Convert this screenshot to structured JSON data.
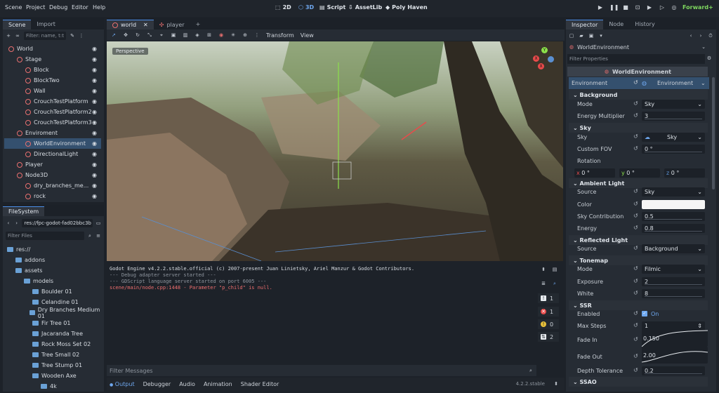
{
  "menu": [
    "Scene",
    "Project",
    "Debug",
    "Editor",
    "Help"
  ],
  "workspaces": {
    "w2d": "2D",
    "w3d": "3D",
    "script": "Script",
    "assetlib": "AssetLib",
    "polyhaven": "Poly Haven"
  },
  "renderer": "Forward+",
  "scene_dock": {
    "tabs": [
      "Scene",
      "Import"
    ],
    "filter_placeholder": "Filter: name, t:t",
    "nodes": [
      {
        "label": "World",
        "indent": 0,
        "color": "#e76f6f"
      },
      {
        "label": "Stage",
        "indent": 1,
        "color": "#e76f6f"
      },
      {
        "label": "Block",
        "indent": 2,
        "color": "#e76f6f"
      },
      {
        "label": "BlockTwo",
        "indent": 2,
        "color": "#e76f6f"
      },
      {
        "label": "Wall",
        "indent": 2,
        "color": "#e76f6f"
      },
      {
        "label": "CrouchTestPlatform",
        "indent": 2,
        "color": "#e76f6f"
      },
      {
        "label": "CrouchTestPlatform2",
        "indent": 2,
        "color": "#e76f6f"
      },
      {
        "label": "CrouchTestPlatform3",
        "indent": 2,
        "color": "#e76f6f"
      },
      {
        "label": "Enviroment",
        "indent": 1,
        "color": "#e76f6f"
      },
      {
        "label": "WorldEnvironment",
        "indent": 2,
        "color": "#e76f6f",
        "selected": true
      },
      {
        "label": "DirectionalLight",
        "indent": 2,
        "color": "#e76f6f"
      },
      {
        "label": "Player",
        "indent": 1,
        "color": "#e76f6f"
      },
      {
        "label": "Node3D",
        "indent": 1,
        "color": "#e76f6f"
      },
      {
        "label": "dry_branches_me...",
        "indent": 2,
        "color": "#e76f6f"
      },
      {
        "label": "rock",
        "indent": 2,
        "color": "#e76f6f"
      }
    ]
  },
  "filesystem": {
    "title": "FileSystem",
    "path": "res://fpc-godot-fad02bbc3b",
    "filter_placeholder": "Filter Files",
    "items": [
      {
        "label": "res://",
        "indent": 0
      },
      {
        "label": "addons",
        "indent": 1
      },
      {
        "label": "assets",
        "indent": 1
      },
      {
        "label": "models",
        "indent": 2
      },
      {
        "label": "Boulder 01",
        "indent": 3
      },
      {
        "label": "Celandine 01",
        "indent": 3
      },
      {
        "label": "Dry Branches Medium 01",
        "indent": 3
      },
      {
        "label": "Fir Tree 01",
        "indent": 3
      },
      {
        "label": "Jacaranda Tree",
        "indent": 3
      },
      {
        "label": "Rock Moss Set 02",
        "indent": 3
      },
      {
        "label": "Tree Small 02",
        "indent": 3
      },
      {
        "label": "Tree Stump 01",
        "indent": 3
      },
      {
        "label": "Wooden Axe",
        "indent": 3
      },
      {
        "label": "4k",
        "indent": 4
      }
    ]
  },
  "editor_tabs": [
    "world",
    "player"
  ],
  "viewport_toolbar": {
    "transform": "Transform",
    "view": "View"
  },
  "viewport": {
    "label": "Perspective"
  },
  "output": {
    "lines": [
      {
        "text": "Godot Engine v4.2.2.stable.official (c) 2007-present Juan Linietsky, Ariel Manzur & Godot Contributors.",
        "color": "#d7dce2"
      },
      {
        "text": "--- Debug adapter server started ---",
        "color": "#8d949d"
      },
      {
        "text": "--- GDScript language server started on port 6005 ---",
        "color": "#8d949d"
      },
      {
        "text": "scene/main/node.cpp:1448 - Parameter \"p_child\" is null.",
        "color": "#ef6e6e"
      }
    ],
    "filter_placeholder": "Filter Messages",
    "counts": [
      "1",
      "1",
      "0",
      "2"
    ],
    "bottom_tabs": [
      "Output",
      "Debugger",
      "Audio",
      "Animation",
      "Shader Editor"
    ],
    "version": "4.2.2.stable"
  },
  "inspector": {
    "tabs": [
      "Inspector",
      "Node",
      "History"
    ],
    "object": "WorldEnvironment",
    "filter_placeholder": "Filter Properties",
    "class_header": "WorldEnvironment",
    "environment": {
      "label": "Environment",
      "value": "Environment"
    },
    "sections": {
      "background": "Background",
      "sky": "Sky",
      "ambient": "Ambient Light",
      "reflected": "Reflected Light",
      "tonemap": "Tonemap",
      "ssr": "SSR",
      "ssao": "SSAO"
    },
    "props": {
      "bg_mode": {
        "label": "Mode",
        "value": "Sky"
      },
      "energy": {
        "label": "Energy Multiplier",
        "value": "3"
      },
      "sky": {
        "label": "Sky",
        "value": "Sky"
      },
      "fov": {
        "label": "Custom FOV",
        "value": "0 °"
      },
      "rotation": {
        "label": "Rotation"
      },
      "rot_x": {
        "axis": "x",
        "value": "0 °"
      },
      "rot_y": {
        "axis": "y",
        "value": "0 °"
      },
      "rot_z": {
        "axis": "z",
        "value": "0 °"
      },
      "amb_source": {
        "label": "Source",
        "value": "Sky"
      },
      "amb_color": {
        "label": "Color"
      },
      "sky_contrib": {
        "label": "Sky Contribution",
        "value": "0.5"
      },
      "amb_energy": {
        "label": "Energy",
        "value": "0.8"
      },
      "refl_source": {
        "label": "Source",
        "value": "Background"
      },
      "tm_mode": {
        "label": "Mode",
        "value": "Filmic"
      },
      "exposure": {
        "label": "Exposure",
        "value": "2"
      },
      "white": {
        "label": "White",
        "value": "8"
      },
      "ssr_enabled": {
        "label": "Enabled",
        "value": "On"
      },
      "max_steps": {
        "label": "Max Steps",
        "value": "1"
      },
      "fade_in": {
        "label": "Fade In",
        "value": "0.150"
      },
      "fade_out": {
        "label": "Fade Out",
        "value": "2.00"
      },
      "depth_tol": {
        "label": "Depth Tolerance",
        "value": "0.2"
      }
    }
  }
}
